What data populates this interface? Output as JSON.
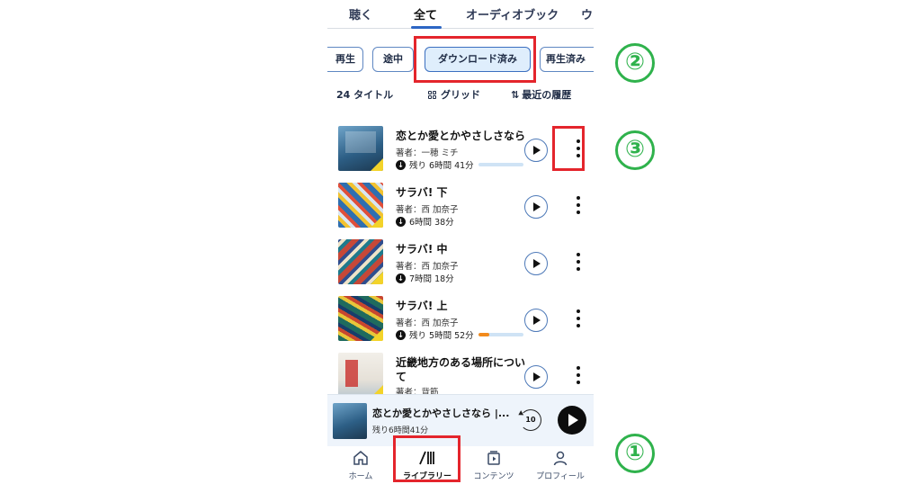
{
  "tabs": [
    "聴く",
    "全て",
    "オーディオブック",
    "ウ"
  ],
  "filters": [
    "再生",
    "途中",
    "ダウンロード済み",
    "再生済み"
  ],
  "toolbar": {
    "count": "24 タイトル",
    "grid_label": "グリッド",
    "sort_label": "最近の履歴"
  },
  "books": [
    {
      "title": "恋とか愛とかやさしさなら",
      "author": "著者：一穂 ミチ",
      "meta": "残り 6時間 41分",
      "progress": 0.0,
      "cover_color": "#3d7aa8"
    },
    {
      "title": "サラバ! 下",
      "author": "著者：西 加奈子",
      "meta": "6時間 38分",
      "progress": null,
      "cover_color": "#2f6fb0"
    },
    {
      "title": "サラバ! 中",
      "author": "著者：西 加奈子",
      "meta": "7時間 18分",
      "progress": null,
      "cover_color": "#c64838"
    },
    {
      "title": "サラバ! 上",
      "author": "著者：西 加奈子",
      "meta": "残り 5時間 52分",
      "progress": 0.25,
      "cover_color": "#1f6b5e"
    },
    {
      "title": "近畿地方のある場所につい",
      "title2": "て",
      "author": "著者：背筋",
      "meta": "",
      "progress": null,
      "cover_color": "#d9d6cf"
    }
  ],
  "mini_player": {
    "title": "恋とか愛とかやさしさなら |...",
    "remaining": "残り6時間41分",
    "rewind_seconds": "10"
  },
  "bottom_nav": [
    "ホーム",
    "ライブラリー",
    "コンテンツ",
    "プロフィール"
  ],
  "annotations": [
    "①",
    "②",
    "③"
  ],
  "colors": {
    "annotation_red": "#e4252c",
    "annotation_green": "#2fb24c",
    "accent_blue": "#2c66c4"
  }
}
